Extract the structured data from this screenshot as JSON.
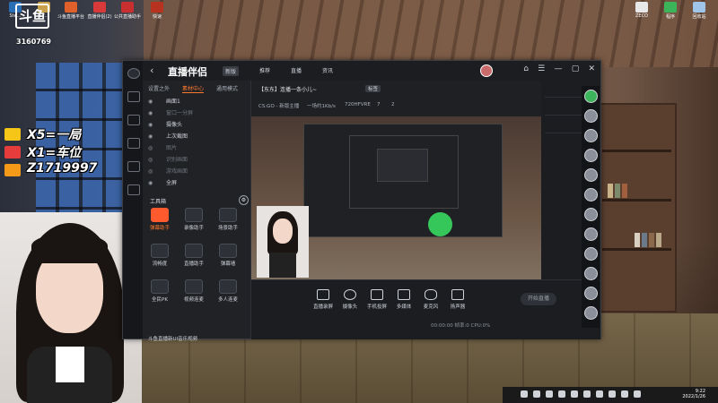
{
  "streamer": {
    "logo": "斗鱼",
    "room_id": "3160769",
    "promos": [
      {
        "text": "X5=一局",
        "icon_color": "#f5c518"
      },
      {
        "text": "X1=车位",
        "icon_color": "#e63c3c"
      },
      {
        "text": "Z1719997",
        "icon_color": "#f59a18"
      }
    ]
  },
  "desktop_icons_top": [
    {
      "label": "Ste...",
      "color": "#2a6fb5"
    },
    {
      "label": "ST...",
      "color": "#c8a14a"
    },
    {
      "label": "斗鱼直播平台",
      "color": "#e0602c"
    },
    {
      "label": "直播伴侣(2)",
      "color": "#d83a3a"
    },
    {
      "label": "公共直播助手",
      "color": "#c92f2f"
    },
    {
      "label": "快速",
      "color": "#b8331f"
    }
  ],
  "desktop_icons_right": [
    {
      "label": "ZECO",
      "color": "#e8e8e8"
    },
    {
      "label": "程序",
      "color": "#3bb45a"
    },
    {
      "label": "回收站",
      "color": "#9fc5e8"
    }
  ],
  "app": {
    "title": "直播伴侣",
    "badge": "新版",
    "title_menus": [
      "推荐",
      "直播",
      "资讯"
    ],
    "window_controls": [
      "⌂",
      "☰",
      "—",
      "▢",
      "✕"
    ],
    "left_tabs": [
      "设置之外",
      "素材中心",
      "通用模式"
    ],
    "layers": [
      {
        "label": "画面1",
        "dim": false
      },
      {
        "label": "窗口一分屏",
        "dim": true
      },
      {
        "label": "摄像头",
        "dim": false
      },
      {
        "label": "上次截图",
        "dim": false
      },
      {
        "label": "图片",
        "dim": true
      },
      {
        "label": "识别画面",
        "dim": true
      },
      {
        "label": "游戏画面",
        "dim": true
      },
      {
        "label": "全屏",
        "dim": false
      }
    ],
    "tools_title": "工具箱",
    "tools_gear": "⚙",
    "tools": [
      {
        "label": "弹幕助手",
        "active": true
      },
      {
        "label": "录像助手",
        "active": false
      },
      {
        "label": "场景助手",
        "active": false
      },
      {
        "label": "流畅度",
        "active": false
      },
      {
        "label": "直播助手",
        "active": false
      },
      {
        "label": "弹幕墙",
        "active": false
      },
      {
        "label": "全民PK",
        "active": false
      },
      {
        "label": "视频连麦",
        "active": false
      },
      {
        "label": "多人连麦",
        "active": false
      }
    ],
    "notice": "斗鱼直播新UI音乐视频",
    "scene_title": "【东东】连播一条小儿~",
    "scene_tag": "标签",
    "scene_info": [
      "CS:GO - 新版主播",
      "一场约1Kb/s",
      "720HFVRE",
      "7",
      "2"
    ],
    "bottom_buttons": [
      "直播录屏",
      "摄像头",
      "手机投屏",
      "多媒体",
      "麦克风",
      "扬声器"
    ],
    "start_label": "开始直播",
    "status_text": "00:00:00  帧率:0  CPU:0%"
  },
  "taskbar": {
    "time": "9:22",
    "date": "2022/1/26"
  }
}
